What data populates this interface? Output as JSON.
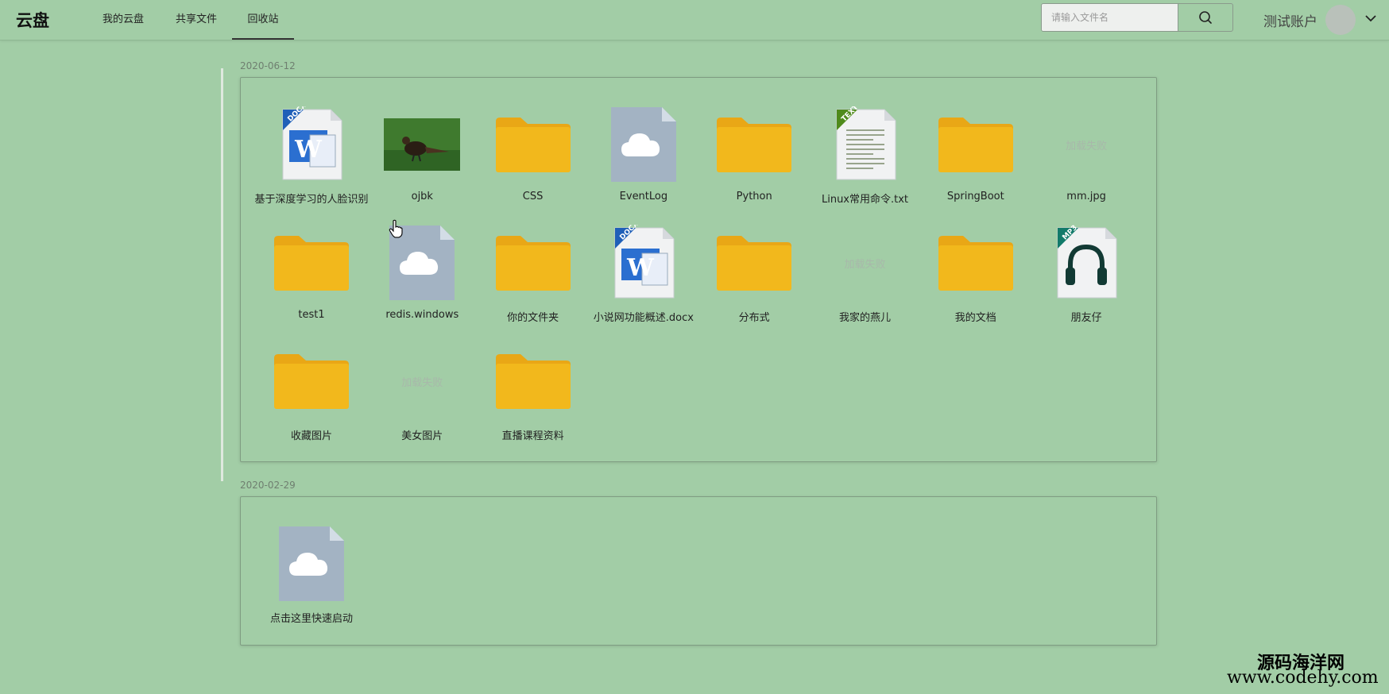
{
  "app": {
    "logo": "云盘"
  },
  "nav": [
    {
      "label": "我的云盘",
      "active": false
    },
    {
      "label": "共享文件",
      "active": false
    },
    {
      "label": "回收站",
      "active": true
    }
  ],
  "search": {
    "placeholder": "请输入文件名",
    "value": "",
    "icon": "search-icon"
  },
  "account": {
    "name": "测试账户",
    "avatar": "avatar",
    "menu_icon": "chevron-down-icon"
  },
  "groups": [
    {
      "date": "2020-06-12",
      "files": [
        {
          "name": "基于深度学习的人脸识别",
          "type": "docx",
          "badge": "DOCX"
        },
        {
          "name": "ojbk",
          "type": "image"
        },
        {
          "name": "CSS",
          "type": "folder"
        },
        {
          "name": "EventLog",
          "type": "cloud"
        },
        {
          "name": "Python",
          "type": "folder"
        },
        {
          "name": "Linux常用命令.txt",
          "type": "txt",
          "badge": "TEXT"
        },
        {
          "name": "SpringBoot",
          "type": "folder"
        },
        {
          "name": "mm.jpg",
          "type": "failed",
          "placeholder": "加载失败"
        },
        {
          "name": "test1",
          "type": "folder"
        },
        {
          "name": "redis.windows",
          "type": "cloud"
        },
        {
          "name": "你的文件夹",
          "type": "folder"
        },
        {
          "name": "小说网功能概述.docx",
          "type": "docx",
          "badge": "DOCX"
        },
        {
          "name": "分布式",
          "type": "folder"
        },
        {
          "name": "我家的燕儿",
          "type": "failed",
          "placeholder": "加载失败"
        },
        {
          "name": "我的文档",
          "type": "folder"
        },
        {
          "name": "朋友仔",
          "type": "mp3",
          "badge": "MP3"
        },
        {
          "name": "收藏图片",
          "type": "folder"
        },
        {
          "name": "美女图片",
          "type": "failed",
          "placeholder": "加载失败"
        },
        {
          "name": "直播课程资料",
          "type": "folder"
        }
      ]
    },
    {
      "date": "2020-02-29",
      "files": [
        {
          "name": "点击这里快速启动",
          "type": "cloud"
        }
      ]
    }
  ],
  "watermark": {
    "cn": "源码海洋网",
    "url": "www.codehy.com"
  },
  "colors": {
    "background": "#a2cda6",
    "folder": "#f2b81c",
    "folder_tab": "#e9a716",
    "cloud_file": "#a3b3c3",
    "docx_blue": "#1f5fb8",
    "text_green": "#4f8a1b",
    "mp3_teal": "#127a6a"
  }
}
